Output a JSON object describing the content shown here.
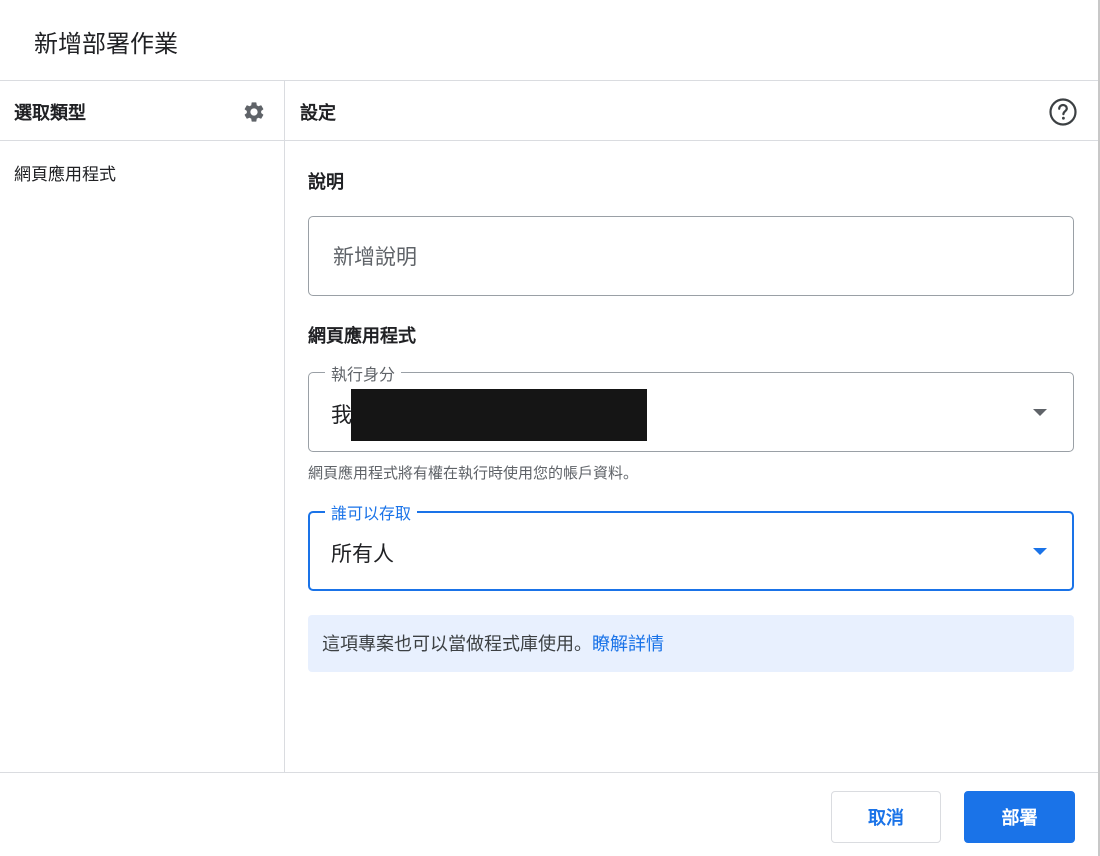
{
  "dialog": {
    "title": "新增部署作業"
  },
  "left_panel": {
    "header": "選取類型",
    "items": [
      {
        "label": "網頁應用程式"
      }
    ]
  },
  "right_panel": {
    "header": "設定",
    "description": {
      "label": "說明",
      "placeholder": "新增說明",
      "value": ""
    },
    "web_app": {
      "section_label": "網頁應用程式",
      "execute_as": {
        "label": "執行身分",
        "value": "我"
      },
      "helper_text": "網頁應用程式將有權在執行時使用您的帳戶資料。",
      "who_has_access": {
        "label": "誰可以存取",
        "value": "所有人"
      }
    },
    "info": {
      "text": "這項專案也可以當做程式庫使用。",
      "link": "瞭解詳情"
    }
  },
  "footer": {
    "cancel_label": "取消",
    "deploy_label": "部署"
  },
  "colors": {
    "accent": "#1a73e8",
    "info_bg": "#e8f0fe",
    "border": "#dadce0"
  },
  "icons": {
    "settings": "gear-icon",
    "help": "help-circle-icon",
    "dropdown": "caret-down-icon"
  }
}
